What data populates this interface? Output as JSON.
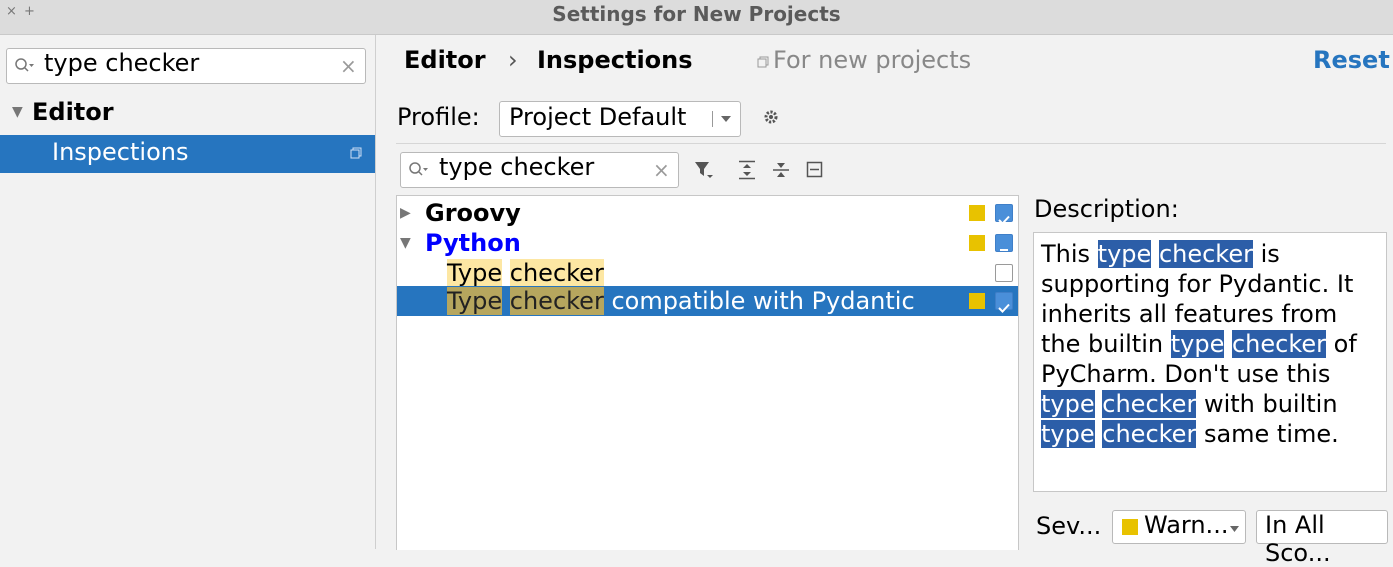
{
  "window": {
    "title": "Settings for New Projects",
    "close_glyph": "×",
    "pin_glyph": "+"
  },
  "sidebar": {
    "search_value": "type checker",
    "clear_glyph": "×",
    "tree": [
      {
        "label": "Editor",
        "expanded": true
      },
      {
        "label": "Inspections",
        "selected": true
      }
    ]
  },
  "header": {
    "breadcrumb_parent": "Editor",
    "breadcrumb_sep": "›",
    "breadcrumb_current": "Inspections",
    "scope_note": "For new projects",
    "reset_label": "Reset"
  },
  "profile": {
    "label": "Profile:",
    "value": "Project Default"
  },
  "filter": {
    "search_value": "type checker",
    "clear_glyph": "×"
  },
  "inspections": {
    "groups": [
      {
        "label": "Groovy",
        "expanded": false,
        "checked": "on",
        "color": "#000000"
      },
      {
        "label": "Python",
        "expanded": true,
        "checked": "mixed",
        "color": "#0000ff"
      }
    ],
    "items": [
      {
        "word1": "Type",
        "word2": "checker",
        "rest": "",
        "checked": false
      },
      {
        "word1": "Type",
        "word2": "checker",
        "rest": " compatible with Pydantic",
        "checked": true,
        "selected": true
      }
    ]
  },
  "description": {
    "label": "Description:",
    "parts": {
      "p1": "This ",
      "m1": "type",
      "p2": " ",
      "m2": "checker",
      "p3": " is supporting for Pydantic. It inherits all features from the builtin ",
      "m3": "type",
      "p4": " ",
      "m4": "checker",
      "p5": " of PyCharm. Don't use this ",
      "m5": "type",
      "p6": " ",
      "m6": "checker",
      "p7": " with builtin ",
      "m7": "type",
      "p8": " ",
      "m8": "checker",
      "p9": " same time."
    }
  },
  "severity": {
    "label": "Sev...",
    "value": "Warn...",
    "scope": "In All Sco..."
  },
  "colors": {
    "accent": "#2675bf",
    "selection": "#2675bf",
    "warning": "#e8c200"
  }
}
